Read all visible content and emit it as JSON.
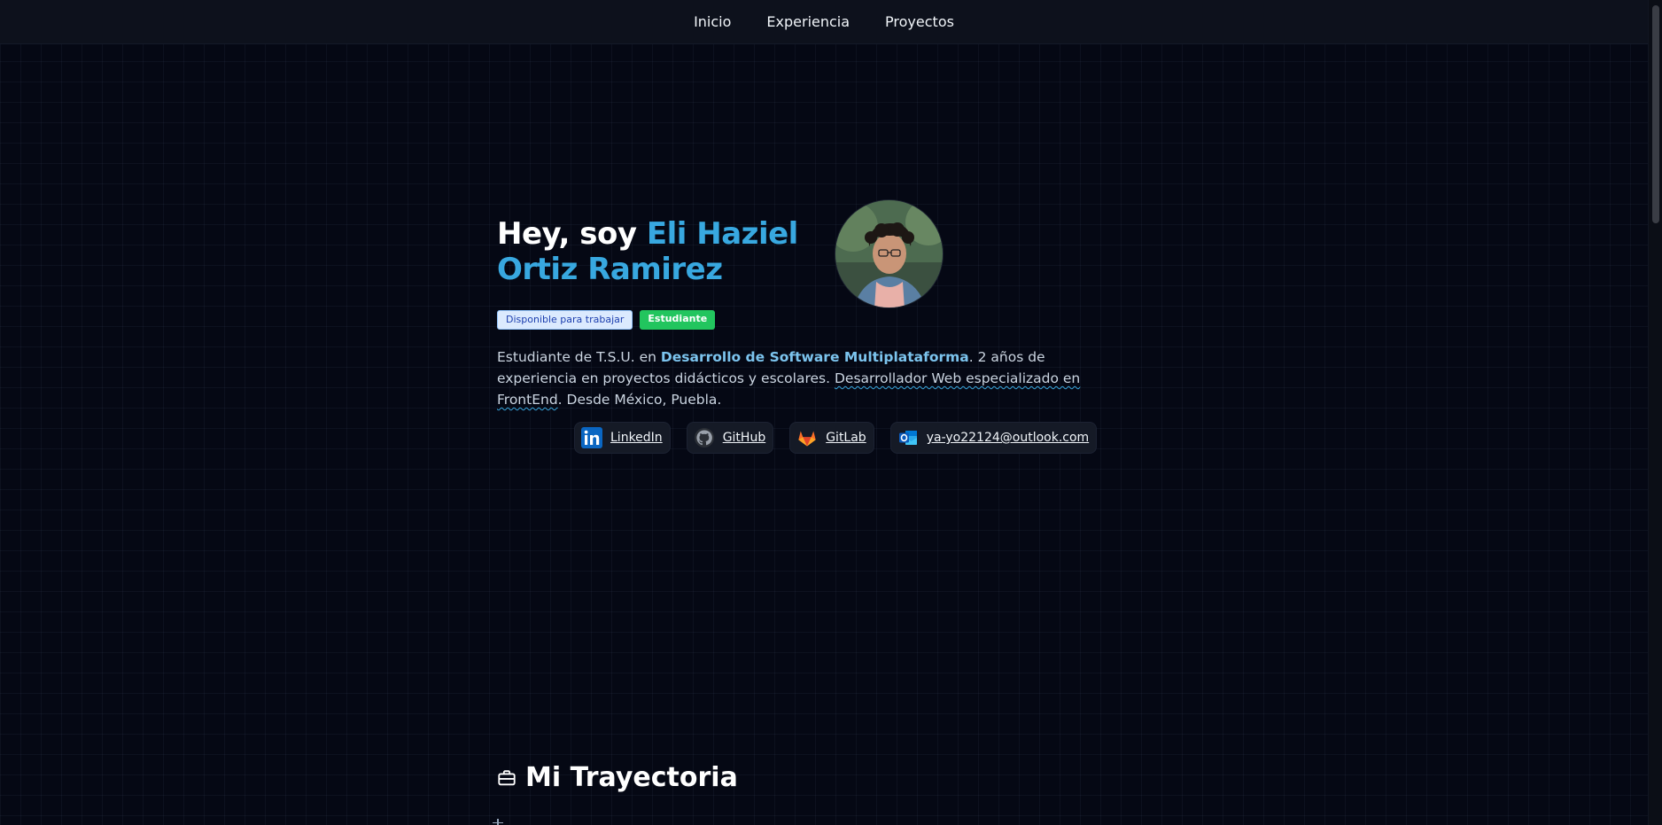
{
  "nav": {
    "items": [
      "Inicio",
      "Experiencia",
      "Proyectos"
    ]
  },
  "hero": {
    "greeting": "Hey, soy ",
    "name": "Eli Haziel Ortiz Ramirez",
    "badges": {
      "available": "Disponible para trabajar",
      "student": "Estudiante"
    },
    "bio": {
      "part1": "Estudiante de T.S.U. en ",
      "highlight": "Desarrollo de Software Multiplataforma",
      "part2": ". 2 años de experiencia en proyectos didácticos y escolares. ",
      "specialty": "Desarrollador Web especializado en FrontEnd",
      "part3": ". Desde México, Puebla."
    },
    "links": {
      "linkedin": "LinkedIn",
      "github": "GitHub",
      "gitlab": "GitLab",
      "email": "ya-yo22124@outlook.com"
    }
  },
  "section": {
    "title": "Mi Trayectoria"
  },
  "icons": {
    "linkedin": "linkedin-icon",
    "github": "github-icon",
    "gitlab": "gitlab-icon",
    "outlook": "outlook-icon",
    "briefcase": "briefcase-icon"
  },
  "colors": {
    "accent": "#38a8e0",
    "background": "#050814",
    "badge_green": "#22c55e",
    "badge_blue": "#dbeafe"
  }
}
